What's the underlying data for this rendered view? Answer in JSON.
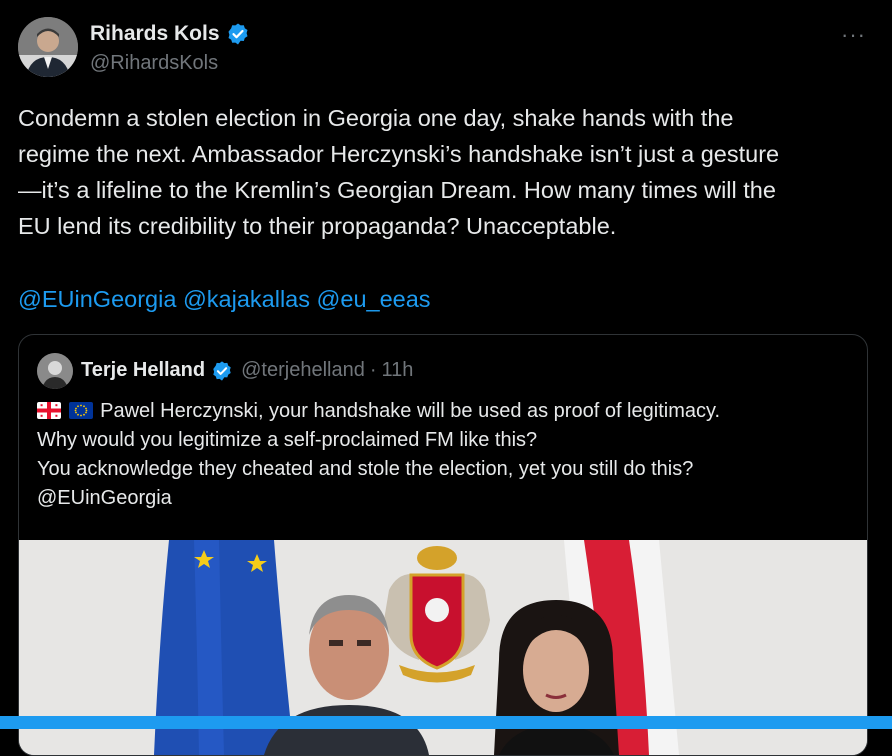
{
  "author": {
    "name": "Rihards Kols",
    "handle": "@RihardsKols"
  },
  "menu": {
    "more_label": "···"
  },
  "tweet": {
    "text_lines": [
      "Condemn a stolen election in Georgia one day, shake hands with the",
      "regime the next. Ambassador Herczynski’s handshake isn’t just a gesture",
      "—it’s a lifeline to the Kremlin’s Georgian Dream. How many times will the",
      "EU lend its credibility to their propaganda? Unacceptable."
    ],
    "mentions": [
      "@EUinGeorgia",
      "@kajakallas",
      "@eu_eeas"
    ]
  },
  "quoted": {
    "name": "Terje Helland",
    "handle": "@terjehelland",
    "separator": "·",
    "time": "11h",
    "text_lines": [
      "Pawel Herczynski, your handshake will be used as proof of legitimacy.",
      "Why would you legitimize a self-proclaimed FM like this?",
      "You acknowledge they cheated and stole the election, yet you still do this?",
      "@EUinGeorgia"
    ]
  },
  "colors": {
    "background": "#000000",
    "text": "#e7e9ea",
    "muted": "#71767b",
    "link": "#1d9bf0",
    "border": "#2f3336"
  }
}
